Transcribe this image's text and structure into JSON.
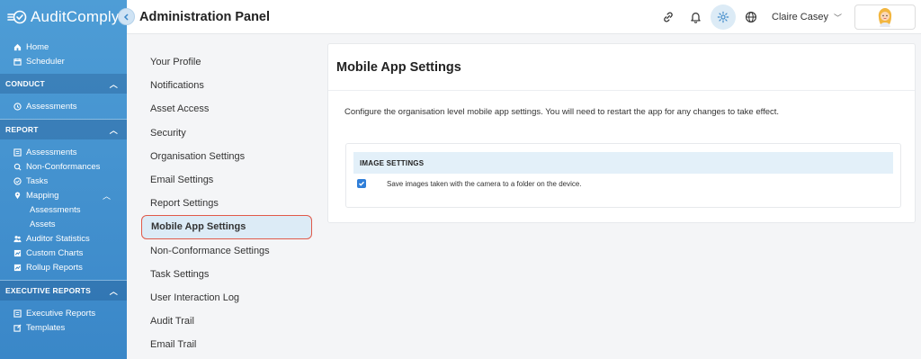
{
  "app": {
    "name": "AuditComply"
  },
  "header": {
    "title": "Administration Panel",
    "user_name": "Claire Casey"
  },
  "sidebar": {
    "top_items": [
      {
        "label": "Home",
        "icon": "home-icon"
      },
      {
        "label": "Scheduler",
        "icon": "calendar-icon"
      }
    ],
    "conduct": {
      "title": "CONDUCT",
      "items": [
        {
          "label": "Assessments",
          "icon": "clock-icon"
        }
      ]
    },
    "report": {
      "title": "REPORT",
      "items": [
        {
          "label": "Assessments",
          "icon": "list-icon"
        },
        {
          "label": "Non-Conformances",
          "icon": "search-icon"
        },
        {
          "label": "Tasks",
          "icon": "tasks-icon"
        },
        {
          "label": "Mapping",
          "icon": "map-pin-icon"
        }
      ],
      "mapping_sub": [
        "Assessments",
        "Assets"
      ],
      "more_items": [
        {
          "label": "Auditor Statistics",
          "icon": "users-icon"
        },
        {
          "label": "Custom Charts",
          "icon": "chart-icon"
        },
        {
          "label": "Rollup Reports",
          "icon": "chart-icon"
        }
      ]
    },
    "executive": {
      "title": "EXECUTIVE REPORTS",
      "items": [
        {
          "label": "Executive Reports",
          "icon": "list-icon"
        },
        {
          "label": "Templates",
          "icon": "edit-icon"
        }
      ]
    }
  },
  "menu": {
    "items": [
      "Your Profile",
      "Notifications",
      "Asset Access",
      "Security",
      "Organisation Settings",
      "Email Settings",
      "Report Settings",
      "Mobile App Settings",
      "Non-Conformance Settings",
      "Task Settings",
      "User Interaction Log",
      "Audit Trail",
      "Email Trail"
    ],
    "active": "Mobile App Settings"
  },
  "card": {
    "title": "Mobile App Settings",
    "description": "Configure the organisation level mobile app settings. You will need to restart the app for any changes to take effect.",
    "section_title": "IMAGE SETTINGS",
    "option_label": "Save images taken with the camera to a folder on the device.",
    "option_checked": true
  },
  "colors": {
    "sidebar": "#3a87c8",
    "accent": "#2f7ed8",
    "highlight": "#dcebf6",
    "active_border": "#e05a4a"
  }
}
